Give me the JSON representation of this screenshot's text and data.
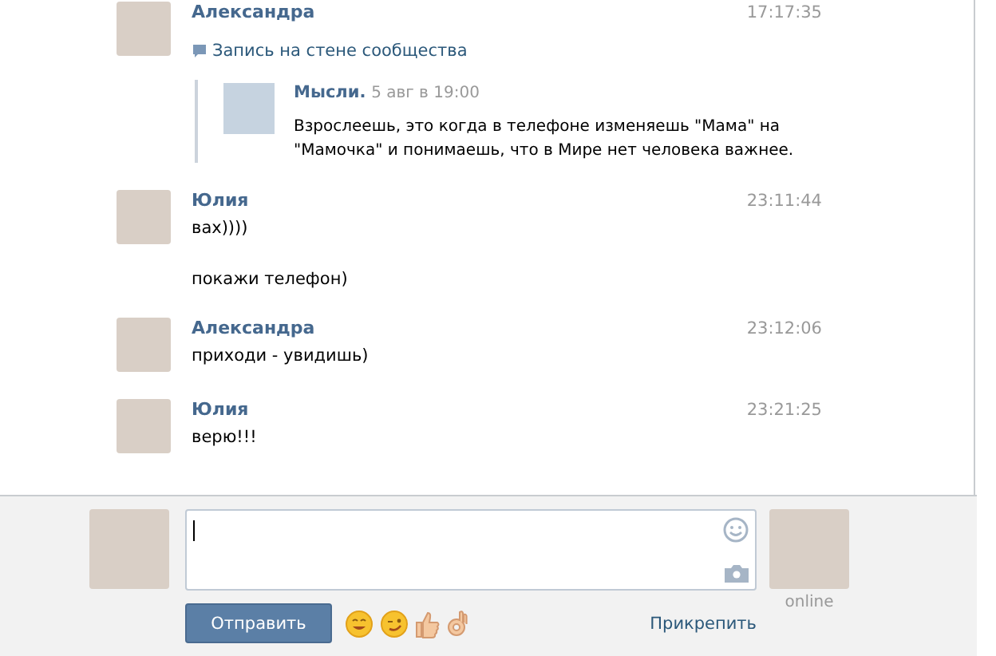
{
  "messages": [
    {
      "author": "Александра",
      "time": "17:17:35",
      "attachment": {
        "label": "Запись на стене сообщества",
        "source": "Мысли.",
        "date": "5 авг в 19:00",
        "text": "Взрослеешь, это когда в телефоне изменяешь \"Мама\" на \"Мамочка\" и понимаешь, что в Мире нет человека важнее."
      }
    },
    {
      "author": "Юлия",
      "time": "23:11:44",
      "texts": [
        "вах))))",
        "покажи телефон)"
      ]
    },
    {
      "author": "Александра",
      "time": "23:12:06",
      "texts": [
        "приходи - увидишь)"
      ]
    },
    {
      "author": "Юлия",
      "time": "23:21:25",
      "texts": [
        "верю!!!"
      ]
    }
  ],
  "composer": {
    "send_button": "Отправить",
    "attach_link": "Прикрепить",
    "status": "online"
  }
}
